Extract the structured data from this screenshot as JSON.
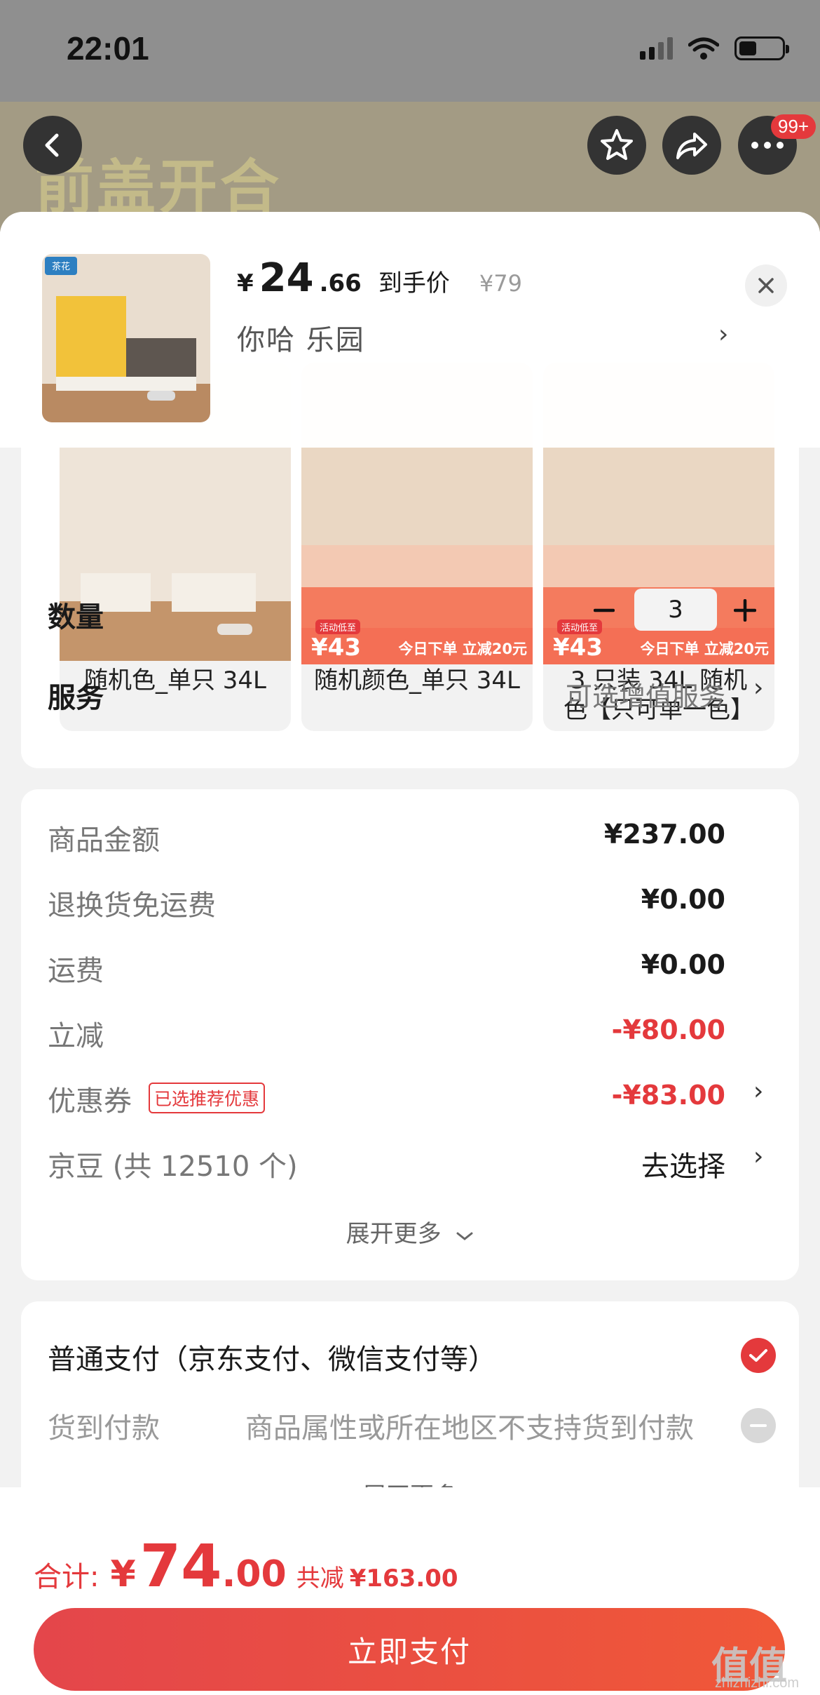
{
  "status_bar": {
    "time": "22:01"
  },
  "background": {
    "banner_text": "前盖开合",
    "more_badge": "99+"
  },
  "product": {
    "thumb_logo": "茶花",
    "price_symbol": "¥",
    "price_int": "24",
    "price_dec": ".66",
    "price_tag": "到手价",
    "orig_price": "¥79",
    "address": "你哈  乐园"
  },
  "variants": [
    {
      "label": "随机色_单只 34L"
    },
    {
      "label": "随机颜色_单只 34L",
      "promo_tag": "活动低至",
      "promo_price": "¥43",
      "promo_text": "今日下单 立减20元"
    },
    {
      "label": "3 只装 34L 随机色【只可单一色】",
      "promo_tag": "活动低至",
      "promo_price": "¥43",
      "promo_text": "今日下单 立减20元"
    }
  ],
  "quantity": {
    "label": "数量",
    "value": "3"
  },
  "service": {
    "label": "服务",
    "value": "可选增值服务"
  },
  "summary": {
    "goods_amount": {
      "label": "商品金额",
      "value": "¥237.00"
    },
    "return_freight": {
      "label": "退换货免运费",
      "value": "¥0.00"
    },
    "freight": {
      "label": "运费",
      "value": "¥0.00"
    },
    "instant_discount": {
      "label": "立减",
      "value": "-¥80.00"
    },
    "coupon": {
      "label": "优惠券",
      "tag": "已选推荐优惠",
      "value": "-¥83.00"
    },
    "jingdou": {
      "label": "京豆 (共 12510 个)",
      "value": "去选择"
    },
    "expand": "展开更多"
  },
  "payment": {
    "normal": "普通支付（京东支付、微信支付等）",
    "cod_label": "货到付款",
    "cod_note": "商品属性或所在地区不支持货到付款",
    "expand": "展开更多"
  },
  "total": {
    "label": "合计:",
    "symbol": "¥",
    "amount_int": "74",
    "amount_dec": ".00",
    "saved_label": "共减",
    "saved_value": "¥163.00"
  },
  "pay_button": "立即支付",
  "watermark": {
    "main": "值值值",
    "sub": "zhizhizhi.com"
  },
  "colors": {
    "accent": "#e4393c",
    "pay_gradient_start": "#e4464b",
    "pay_gradient_end": "#f05838"
  }
}
